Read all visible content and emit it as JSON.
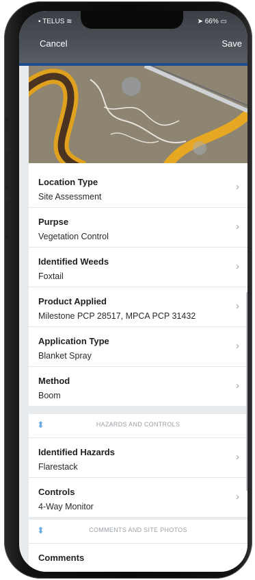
{
  "status_bar": {
    "carrier": "TELUS",
    "battery": "66%"
  },
  "nav": {
    "cancel_label": "Cancel",
    "save_label": "Save"
  },
  "fields": [
    {
      "label": "Location Type",
      "value": "Site Assessment"
    },
    {
      "label": "Purpse",
      "value": "Vegetation Control"
    },
    {
      "label": "Identified Weeds",
      "value": "Foxtail"
    },
    {
      "label": "Product Applied",
      "value": "Milestone PCP 28517, MPCA PCP 31432"
    },
    {
      "label": "Application Type",
      "value": "Blanket Spray"
    },
    {
      "label": "Method",
      "value": "Boom"
    }
  ],
  "hazards_section": {
    "title": "HAZARDS AND CONTROLS",
    "fields": [
      {
        "label": "Identified Hazards",
        "value": "Flarestack"
      },
      {
        "label": "Controls",
        "value": "4-Way Monitor"
      }
    ]
  },
  "comments_section": {
    "title": "COMMENTS AND SITE PHOTOS",
    "fields": [
      {
        "label": "Comments"
      }
    ]
  }
}
